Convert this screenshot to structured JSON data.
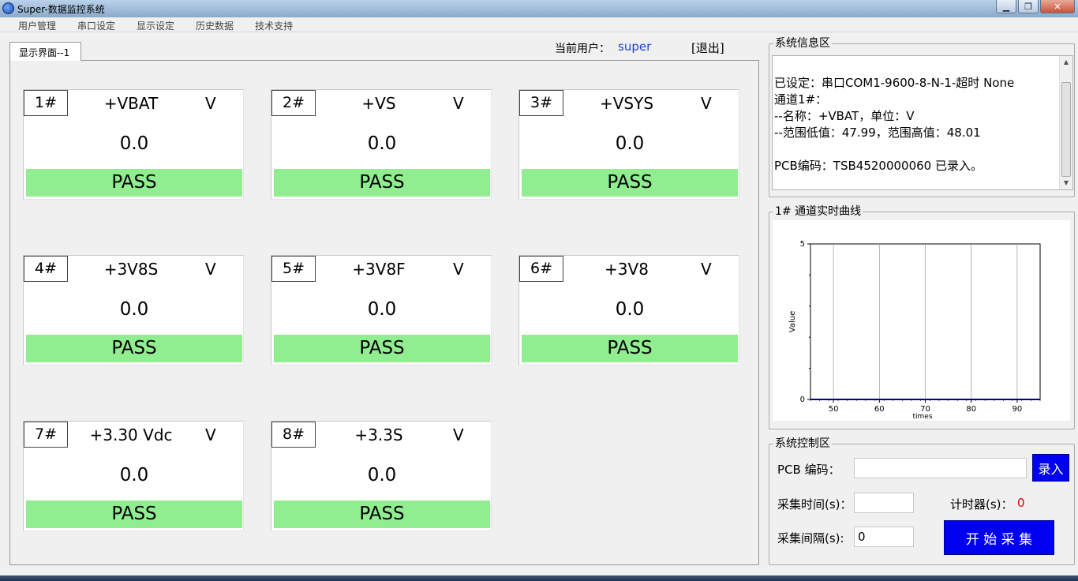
{
  "window": {
    "title": "Super-数据监控系统",
    "buttons": {
      "minimize": "▁",
      "maximize": "❐",
      "close": "✕"
    }
  },
  "menu": [
    "用户管理",
    "串口设定",
    "显示设定",
    "历史数据",
    "技术支持"
  ],
  "tab_label": "显示界面--1",
  "user": {
    "label": "当前用户：",
    "name": "super",
    "logout": "[退出]"
  },
  "channels": [
    {
      "num": "1#",
      "name": "+VBAT",
      "unit": "V",
      "value": "0.0",
      "status": "PASS"
    },
    {
      "num": "2#",
      "name": "+VS",
      "unit": "V",
      "value": "0.0",
      "status": "PASS"
    },
    {
      "num": "3#",
      "name": "+VSYS",
      "unit": "V",
      "value": "0.0",
      "status": "PASS"
    },
    {
      "num": "4#",
      "name": "+3V8S",
      "unit": "V",
      "value": "0.0",
      "status": "PASS"
    },
    {
      "num": "5#",
      "name": "+3V8F",
      "unit": "V",
      "value": "0.0",
      "status": "PASS"
    },
    {
      "num": "6#",
      "name": "+3V8",
      "unit": "V",
      "value": "0.0",
      "status": "PASS"
    },
    {
      "num": "7#",
      "name": "+3.30 Vdc",
      "unit": "V",
      "value": "0.0",
      "status": "PASS"
    },
    {
      "num": "8#",
      "name": "+3.3S",
      "unit": "V",
      "value": "0.0",
      "status": "PASS"
    }
  ],
  "status_color": "#90ee90",
  "system_info": {
    "title": "系统信息区",
    "lines": [
      "已设定：串口COM1-9600-8-N-1-超时 None",
      "通道1#：",
      "--名称：+VBAT，单位：V",
      "--范围低值：47.99，范围高值：48.01",
      "",
      "PCB编码：TSB4520000060 已录入。"
    ]
  },
  "realtime": {
    "title": "1# 通道实时曲线"
  },
  "chart_data": {
    "type": "line",
    "title": "",
    "xlabel": "times",
    "ylabel": "Value",
    "xlim": [
      45,
      95
    ],
    "ylim": [
      0,
      5
    ],
    "x_ticks": [
      50,
      60,
      70,
      80,
      90
    ],
    "y_ticks": [
      0,
      5
    ],
    "grid": "vertical",
    "series": [
      {
        "x": [
          45,
          95
        ],
        "values": [
          0,
          0
        ],
        "color": "#000080"
      }
    ]
  },
  "control": {
    "title": "系统控制区",
    "pcb_label": "PCB 编码：",
    "pcb_value": "",
    "record_button": "录入",
    "collect_time_label": "采集时间(s)：",
    "collect_time_value": "",
    "timer_label": "计时器(s)：",
    "timer_value": "0",
    "interval_label": "采集间隔(s):",
    "interval_value": "0",
    "start_button": "开 始 采 集"
  }
}
